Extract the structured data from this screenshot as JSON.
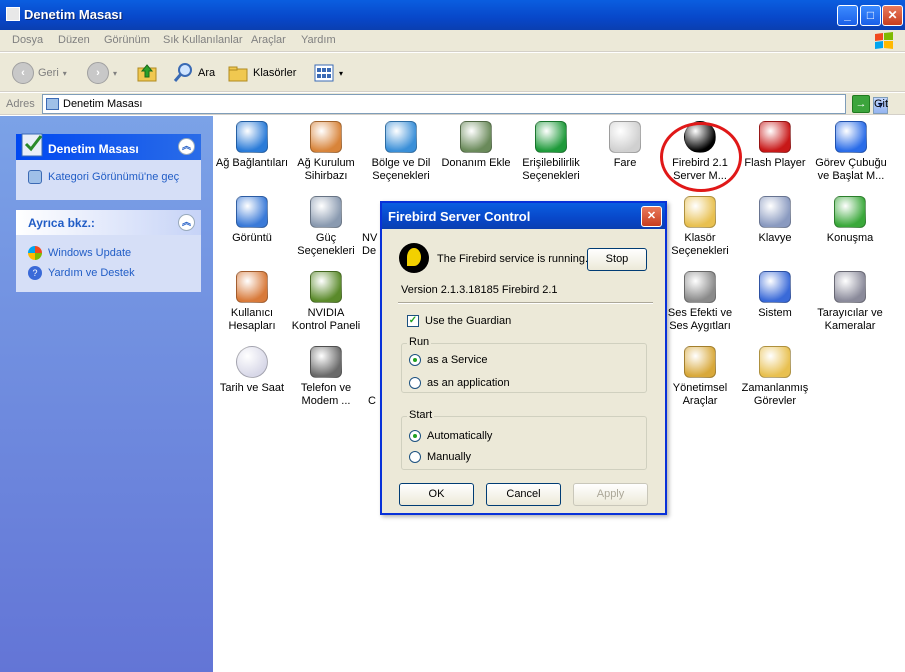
{
  "window": {
    "title": "Denetim Masası"
  },
  "menu": [
    "Dosya",
    "Düzen",
    "Görünüm",
    "Sık Kullanılanlar",
    "Araçlar",
    "Yardım"
  ],
  "toolbar": {
    "back": "Geri",
    "search": "Ara",
    "folders": "Klasörler"
  },
  "address": {
    "label": "Adres",
    "value": "Denetim Masası",
    "go": "Git"
  },
  "sidebar": {
    "panel1": {
      "title": "Denetim Masası",
      "link": "Kategori Görünümü'ne geç"
    },
    "panel2": {
      "title": "Ayrıca bkz.:",
      "links": [
        "Windows Update",
        "Yardım ve Destek"
      ]
    }
  },
  "items": [
    {
      "label": "Ağ Bağlantıları",
      "icon": "network-globe-icon",
      "color": "#2a7bd8"
    },
    {
      "label": "Ağ Kurulum\nSihirbazı",
      "icon": "home-network-icon",
      "color": "#d8843a"
    },
    {
      "label": "Bölge ve Dil\nSeçenekleri",
      "icon": "globe-icon",
      "color": "#3a8fd8"
    },
    {
      "label": "Donanım Ekle",
      "icon": "hardware-icon",
      "color": "#6a8a5a"
    },
    {
      "label": "Erişilebilirlik\nSeçenekleri",
      "icon": "accessibility-icon",
      "color": "#1e9a3a"
    },
    {
      "label": "Fare",
      "icon": "mouse-icon",
      "color": "#d0d0d0"
    },
    {
      "label": "Firebird 2.1\nServer M...",
      "icon": "firebird-icon",
      "color": "#000000"
    },
    {
      "label": "Flash Player",
      "icon": "flash-icon",
      "color": "#c81818"
    },
    {
      "label": "Görev Çubuğu\nve Başlat M...",
      "icon": "taskbar-icon",
      "color": "#2a6ce8"
    },
    {
      "label": "Görüntü",
      "icon": "display-icon",
      "color": "#3a7ad8"
    },
    {
      "label": "Güç\nSeçenekleri",
      "icon": "power-icon",
      "color": "#8a9ab0"
    },
    {
      "label": "NV\nDe",
      "icon": "nvidia-partial-icon",
      "color": "#5a8a2a"
    },
    {
      "label": "Klasör\nSeçenekleri",
      "icon": "folder-options-icon",
      "color": "#e8c050"
    },
    {
      "label": "Klavye",
      "icon": "keyboard-icon",
      "color": "#8a9ac0"
    },
    {
      "label": "Konuşma",
      "icon": "speech-icon",
      "color": "#3aa83a"
    },
    {
      "label": "Kullanıcı\nHesapları",
      "icon": "users-icon",
      "color": "#d87a3a"
    },
    {
      "label": "NVIDIA\nKontrol Paneli",
      "icon": "nvidia-icon",
      "color": "#5a8a2a"
    },
    {
      "label": "Ses Efekti ve\nSes Aygıtları",
      "icon": "speaker-icon",
      "color": "#8a8a8a"
    },
    {
      "label": "Sistem",
      "icon": "system-icon",
      "color": "#3a6ad8"
    },
    {
      "label": "Tarayıcılar ve\nKameralar",
      "icon": "scanner-camera-icon",
      "color": "#8a8a9a"
    },
    {
      "label": "Tarih ve Saat",
      "icon": "clock-icon",
      "color": "#d8d8e8"
    },
    {
      "label": "Telefon ve\nModem ...",
      "icon": "phone-modem-icon",
      "color": "#6a6a6a"
    },
    {
      "label": "C",
      "icon": "partial-icon",
      "color": "#8a8a8a"
    },
    {
      "label": "Yönetimsel\nAraçlar",
      "icon": "admin-tools-icon",
      "color": "#d8a83a"
    },
    {
      "label": "Zamanlanmış\nGörevler",
      "icon": "scheduled-tasks-icon",
      "color": "#e8c050"
    }
  ],
  "dialog": {
    "title": "Firebird Server Control",
    "status": "The Firebird service is running.",
    "stop": "Stop",
    "version": "Version 2.1.3.18185 Firebird 2.1",
    "guardian": "Use the Guardian",
    "run_group": "Run",
    "run_service": "as a Service",
    "run_app": "as an application",
    "start_group": "Start",
    "start_auto": "Automatically",
    "start_manual": "Manually",
    "ok": "OK",
    "cancel": "Cancel",
    "apply": "Apply"
  }
}
